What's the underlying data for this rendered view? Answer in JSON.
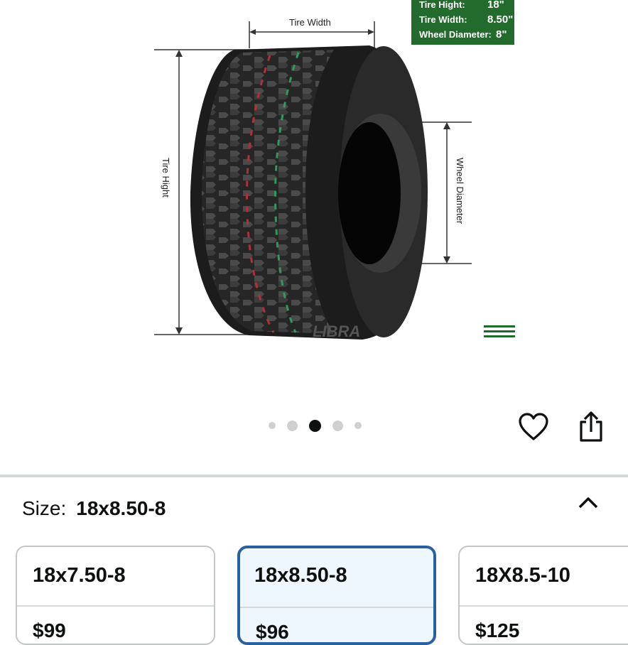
{
  "image": {
    "spec_box": {
      "tire_height_label": "Tire Hight:",
      "tire_height_value": "18\"",
      "tire_width_label": "Tire Width:",
      "tire_width_value": "8.50\"",
      "wheel_diameter_label": "Wheel Diameter:",
      "wheel_diameter_value": "8\""
    },
    "dimension_labels": {
      "tire_width": "Tire Width",
      "tire_height": "Tire Hight",
      "wheel_diameter": "Wheel Diameter"
    },
    "watermark": "LIBRA",
    "gallery": {
      "total": 5,
      "active_index": 3
    },
    "colors": {
      "spec_box_bg": "#236b2c",
      "menu_icon": "#1f6b2b"
    }
  },
  "actions": {
    "favorite_icon": "heart-icon",
    "share_icon": "share-icon"
  },
  "size_selector": {
    "label": "Size:",
    "selected": "18x8.50-8",
    "collapse_icon": "chevron-up-icon",
    "options": [
      {
        "name": "18x7.50-8",
        "price": "$99",
        "selected": false
      },
      {
        "name": "18x8.50-8",
        "price": "$96",
        "selected": true
      },
      {
        "name": "18X8.5-10",
        "price": "$125",
        "selected": false
      }
    ],
    "colors": {
      "selected_border": "#2a5fa0",
      "selected_bg": "#edf7fd"
    }
  }
}
